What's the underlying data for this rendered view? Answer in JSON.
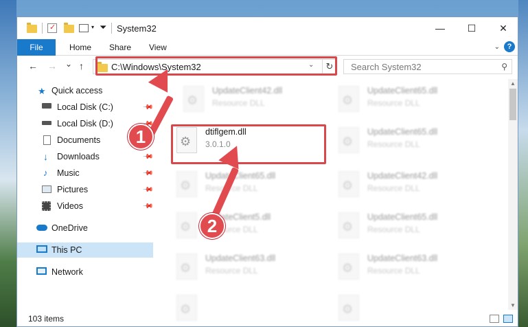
{
  "window": {
    "title": "System32",
    "controls": {
      "minimize": "—",
      "maximize": "☐",
      "close": "✕"
    }
  },
  "ribbon": {
    "tabs": [
      "File",
      "Home",
      "Share",
      "View"
    ],
    "help": "?"
  },
  "nav": {
    "back": "←",
    "forward": "→",
    "recent": "⌄",
    "up": "↑"
  },
  "address": {
    "path": "C:\\Windows\\System32",
    "refresh": "↻"
  },
  "search": {
    "placeholder": "Search System32"
  },
  "sidebar": {
    "items": [
      {
        "label": "Quick access",
        "icon": "star-icon"
      },
      {
        "label": "Local Disk (C:)",
        "icon": "drive-icon",
        "pinned": true
      },
      {
        "label": "Local Disk (D:)",
        "icon": "drive-icon",
        "pinned": true
      },
      {
        "label": "Documents",
        "icon": "documents-icon",
        "pinned": true
      },
      {
        "label": "Downloads",
        "icon": "download-icon",
        "pinned": true
      },
      {
        "label": "Music",
        "icon": "music-icon",
        "pinned": true
      },
      {
        "label": "Pictures",
        "icon": "pictures-icon",
        "pinned": true
      },
      {
        "label": "Videos",
        "icon": "videos-icon",
        "pinned": true
      },
      {
        "label": "OneDrive",
        "icon": "cloud-icon"
      },
      {
        "label": "This PC",
        "icon": "computer-icon",
        "selected": true
      },
      {
        "label": "Network",
        "icon": "network-icon"
      }
    ]
  },
  "files": {
    "highlighted": {
      "name": "dtiflgem.dll",
      "version": "3.0.1.0"
    },
    "background": [
      {
        "name": "UpdateClient42.dll",
        "type": "Resource DLL"
      },
      {
        "name": "UpdateClient65.dll",
        "type": "Resource DLL"
      },
      {
        "name": "UpdateClient65.dll",
        "type": "Resource DLL"
      },
      {
        "name": "UpdateClient65.dll",
        "type": "Resource DLL"
      },
      {
        "name": "UpdateClient42.dll",
        "type": "Resource DLL"
      },
      {
        "name": "UpdateClient5.dll",
        "type": "Resource DLL"
      },
      {
        "name": "UpdateClient65.dll",
        "type": "Resource DLL"
      },
      {
        "name": "UpdateClient63.dll",
        "type": "Resource DLL"
      },
      {
        "name": "UpdateClient63.dll",
        "type": "Resource DLL"
      }
    ]
  },
  "status": {
    "item_count": "103 items"
  },
  "annotations": {
    "step1": "1",
    "step2": "2",
    "color": "#e14a4e"
  }
}
